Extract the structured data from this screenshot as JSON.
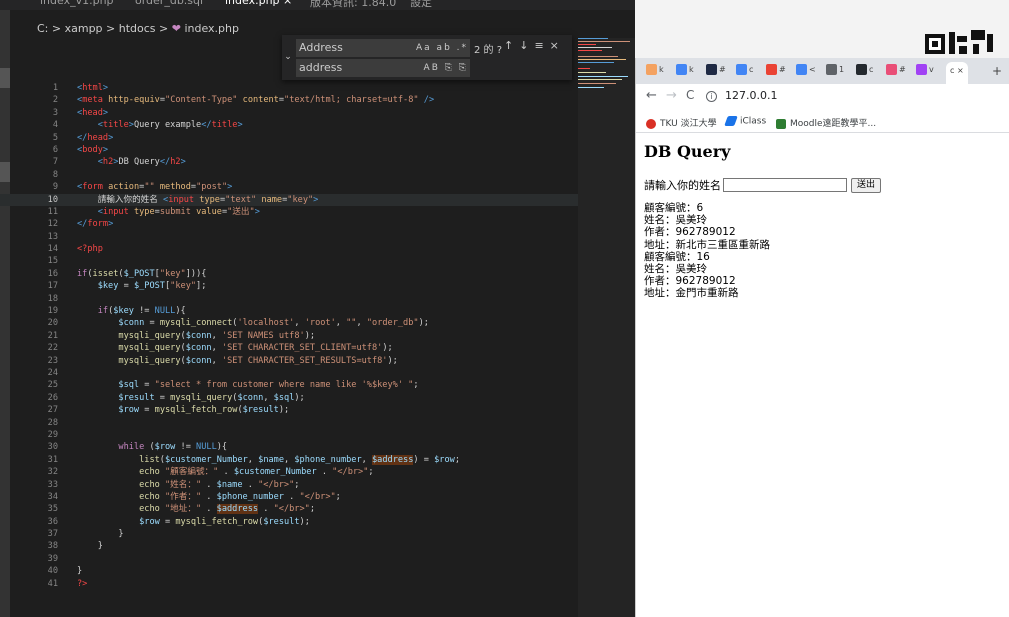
{
  "editor": {
    "tabs": [
      "index_v1.php",
      "order_db.sql",
      "index.php ×",
      "版本資訊: 1.84.0",
      "設定"
    ],
    "breadcrumb": {
      "path": "C: > xampp > htdocs > ",
      "file": "index.php"
    },
    "find": {
      "search_value": "Address",
      "replace_value": "address",
      "match_count": "2 的 ?",
      "search_options": "Aa ab .*",
      "replace_options": "AB ⎘ ⎘"
    },
    "code_lines": [
      {
        "n": "1",
        "html": "<span class='tk'>&lt;</span><span class='tg'>html</span><span class='tk'>&gt;</span>"
      },
      {
        "n": "2",
        "html": "<span class='tk'>&lt;</span><span class='tg'>meta</span> <span class='at'>http-equiv</span>=<span class='st'>\"Content-Type\"</span> <span class='at'>content</span>=<span class='st'>\"text/html; charset=utf-8\"</span> <span class='tk'>/&gt;</span>"
      },
      {
        "n": "3",
        "html": "<span class='tk'>&lt;</span><span class='tg'>head</span><span class='tk'>&gt;</span>"
      },
      {
        "n": "4",
        "html": "    <span class='tk'>&lt;</span><span class='tg'>title</span><span class='tk'>&gt;</span>Query example<span class='tk'>&lt;/</span><span class='tg'>title</span><span class='tk'>&gt;</span>"
      },
      {
        "n": "5",
        "html": "<span class='tk'>&lt;/</span><span class='tg'>head</span><span class='tk'>&gt;</span>"
      },
      {
        "n": "6",
        "html": "<span class='tk'>&lt;</span><span class='tg'>body</span><span class='tk'>&gt;</span>"
      },
      {
        "n": "7",
        "html": "    <span class='tk'>&lt;</span><span class='tg'>h2</span><span class='tk'>&gt;</span>DB Query<span class='tk'>&lt;/</span><span class='tg'>h2</span><span class='tk'>&gt;</span>"
      },
      {
        "n": "8",
        "html": ""
      },
      {
        "n": "9",
        "html": "<span class='tk'>&lt;</span><span class='tg'>form</span> <span class='at'>action</span>=<span class='st'>\"\"</span> <span class='at'>method</span>=<span class='st'>\"post\"</span><span class='tk'>&gt;</span>"
      },
      {
        "n": "10",
        "html": "    請輸入你的姓名 <span class='tk'>&lt;</span><span class='tg'>input</span> <span class='at'>type</span>=<span class='st'>\"text\"</span> <span class='at'>name</span>=<span class='st'>\"key\"</span><span class='tk'>&gt;</span>",
        "hl": true
      },
      {
        "n": "11",
        "html": "    <span class='tk'>&lt;</span><span class='tg'>input</span> <span class='at'>type</span>=<span class='st'>submit</span> <span class='at'>value</span>=<span class='st'>\"送出\"</span><span class='tk'>&gt;</span>"
      },
      {
        "n": "12",
        "html": "<span class='tk'>&lt;/</span><span class='tg'>form</span><span class='tk'>&gt;</span>"
      },
      {
        "n": "13",
        "html": ""
      },
      {
        "n": "14",
        "html": "<span class='ph'>&lt;?php</span>"
      },
      {
        "n": "15",
        "html": ""
      },
      {
        "n": "16",
        "html": "<span class='kw'>if</span>(<span class='fn'>isset</span>(<span class='vr'>$_POST</span>[<span class='st'>\"key\"</span>])){"
      },
      {
        "n": "17",
        "html": "    <span class='vr'>$key</span> = <span class='vr'>$_POST</span>[<span class='st'>\"key\"</span>];"
      },
      {
        "n": "18",
        "html": ""
      },
      {
        "n": "19",
        "html": "    <span class='kw'>if</span>(<span class='vr'>$key</span> != <span class='tk'>NULL</span>){"
      },
      {
        "n": "20",
        "html": "        <span class='vr'>$conn</span> = <span class='fn'>mysqli_connect</span>(<span class='st'>'localhost'</span>, <span class='st'>'root'</span>, <span class='st'>\"\"</span>, <span class='st'>\"order_db\"</span>);"
      },
      {
        "n": "21",
        "html": "        <span class='fn'>mysqli_query</span>(<span class='vr'>$conn</span>, <span class='st'>'SET NAMES utf8'</span>);"
      },
      {
        "n": "22",
        "html": "        <span class='fn'>mysqli_query</span>(<span class='vr'>$conn</span>, <span class='st'>'SET CHARACTER_SET_CLIENT=utf8'</span>);"
      },
      {
        "n": "23",
        "html": "        <span class='fn'>mysqli_query</span>(<span class='vr'>$conn</span>, <span class='st'>'SET CHARACTER_SET_RESULTS=utf8'</span>);"
      },
      {
        "n": "24",
        "html": ""
      },
      {
        "n": "25",
        "html": "        <span class='vr'>$sql</span> = <span class='st'>\"select * from customer where name like '%$key%' \"</span>;"
      },
      {
        "n": "26",
        "html": "        <span class='vr'>$result</span> = <span class='fn'>mysqli_query</span>(<span class='vr'>$conn</span>, <span class='vr'>$sql</span>);"
      },
      {
        "n": "27",
        "html": "        <span class='vr'>$row</span> = <span class='fn'>mysqli_fetch_row</span>(<span class='vr'>$result</span>);"
      },
      {
        "n": "28",
        "html": ""
      },
      {
        "n": "29",
        "html": ""
      },
      {
        "n": "30",
        "html": "        <span class='kw'>while</span> (<span class='vr'>$row</span> != <span class='tk'>NULL</span>){"
      },
      {
        "n": "31",
        "html": "            <span class='fn'>list</span>(<span class='vr'>$customer_Number</span>, <span class='vr'>$name</span>, <span class='vr'>$phone_number</span>, <span class='vr mh'>$address</span>) = <span class='vr'>$row</span>;"
      },
      {
        "n": "32",
        "html": "            <span class='fn'>echo</span> <span class='st'>\"顧客編號：\"</span> . <span class='vr'>$customer_Number</span> . <span class='st'>\"&lt;/br&gt;\"</span>;"
      },
      {
        "n": "33",
        "html": "            <span class='fn'>echo</span> <span class='st'>\"姓名：\"</span> . <span class='vr'>$name</span> . <span class='st'>\"&lt;/br&gt;\"</span>;"
      },
      {
        "n": "34",
        "html": "            <span class='fn'>echo</span> <span class='st'>\"作者：\"</span> . <span class='vr'>$phone_number</span> . <span class='st'>\"&lt;/br&gt;\"</span>;"
      },
      {
        "n": "35",
        "html": "            <span class='fn'>echo</span> <span class='st'>\"地址：\"</span> . <span class='vr mh'>$address</span> . <span class='st'>\"&lt;/br&gt;\"</span>;"
      },
      {
        "n": "36",
        "html": "            <span class='vr'>$row</span> = <span class='fn'>mysqli_fetch_row</span>(<span class='vr'>$result</span>);"
      },
      {
        "n": "37",
        "html": "        }"
      },
      {
        "n": "38",
        "html": "    }"
      },
      {
        "n": "39",
        "html": ""
      },
      {
        "n": "40",
        "html": "}"
      },
      {
        "n": "41",
        "html": "<span class='ph'>?&gt;</span>"
      }
    ]
  },
  "browser": {
    "address": "127.0.0.1",
    "bookmarks": [
      "TKU 淡江大學",
      "iClass",
      "Moodle遠距教學平..."
    ],
    "page": {
      "heading": "DB Query",
      "form_label": "請輸入你的姓名",
      "submit_label": "送出",
      "results": [
        "顧客編號：6",
        "姓名：吳美玲",
        "作者：962789012",
        "地址：新北市三重區重新路",
        "顧客編號：16",
        "姓名：吳美玲",
        "作者：962789012",
        "地址：金門市重新路"
      ]
    }
  }
}
